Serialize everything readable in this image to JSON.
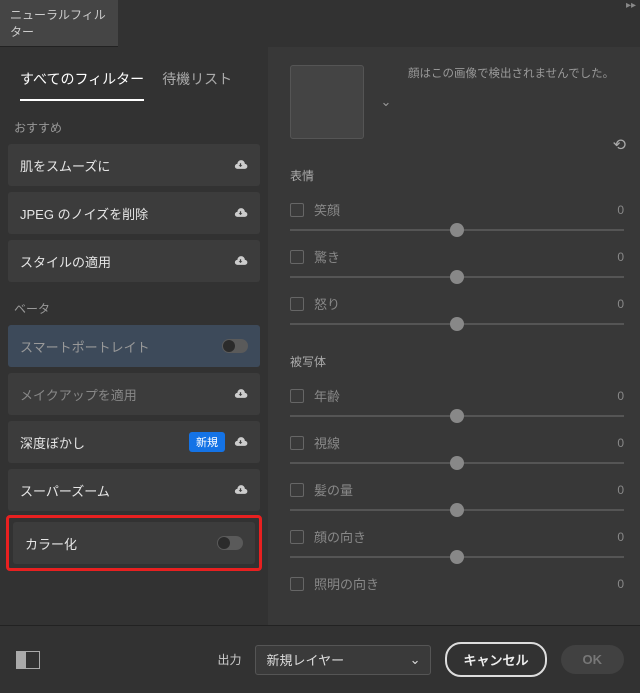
{
  "title": "ニューラルフィルター",
  "tabs": {
    "all": "すべてのフィルター",
    "wait": "待機リスト"
  },
  "sections": {
    "featured": "おすすめ",
    "beta": "ベータ"
  },
  "filters": {
    "featured": [
      {
        "label": "肌をスムーズに",
        "cloud": true
      },
      {
        "label": "JPEG のノイズを削除",
        "cloud": true
      },
      {
        "label": "スタイルの適用",
        "cloud": true
      }
    ],
    "beta": [
      {
        "label": "スマートポートレイト",
        "toggle": true,
        "selected": true
      },
      {
        "label": "メイクアップを適用",
        "cloud": true,
        "disabled": true
      },
      {
        "label": "深度ぼかし",
        "badge": "新規",
        "cloud": true
      },
      {
        "label": "スーパーズーム",
        "cloud": true
      },
      {
        "label": "カラー化",
        "toggle": true,
        "highlighted": true
      }
    ]
  },
  "rightPanel": {
    "detectMsg": "顔はこの画像で検出されませんでした。",
    "groups": {
      "expression": "表情",
      "subject": "被写体"
    },
    "sliders": {
      "smile": {
        "label": "笑顔",
        "value": "0"
      },
      "surprise": {
        "label": "驚き",
        "value": "0"
      },
      "anger": {
        "label": "怒り",
        "value": "0"
      },
      "age": {
        "label": "年齢",
        "value": "0"
      },
      "gaze": {
        "label": "視線",
        "value": "0"
      },
      "hair": {
        "label": "髪の量",
        "value": "0"
      },
      "faceDir": {
        "label": "顔の向き",
        "value": "0"
      },
      "lightDir": {
        "label": "照明の向き",
        "value": "0"
      }
    }
  },
  "footer": {
    "outputLabel": "出力",
    "outputValue": "新規レイヤー",
    "cancel": "キャンセル",
    "ok": "OK"
  }
}
